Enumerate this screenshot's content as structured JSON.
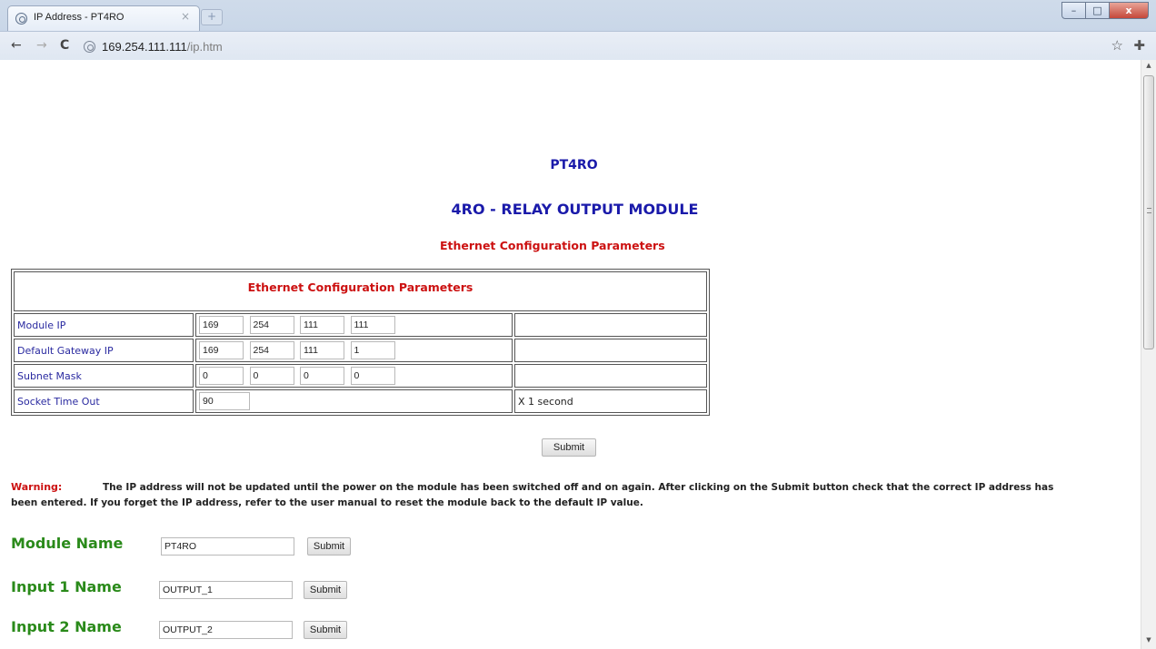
{
  "browser": {
    "tab_title": "IP Address - PT4RO",
    "tab_close": "×",
    "new_tab": "+",
    "url_host": "169.254.111.111",
    "url_path": "/ip.htm",
    "win_min": "–",
    "win_max": "□",
    "win_close": "x"
  },
  "header": {
    "module": "PT4RO",
    "title": "4RO - RELAY OUTPUT MODULE",
    "subtitle": "Ethernet Configuration Parameters"
  },
  "config_table": {
    "heading": "Ethernet Configuration Parameters",
    "rows": [
      {
        "label": "Module IP",
        "octets": [
          "169",
          "254",
          "111",
          "111"
        ],
        "note": ""
      },
      {
        "label": "Default Gateway IP",
        "octets": [
          "169",
          "254",
          "111",
          "1"
        ],
        "note": ""
      },
      {
        "label": "Subnet Mask",
        "octets": [
          "0",
          "0",
          "0",
          "0"
        ],
        "note": ""
      },
      {
        "label": "Socket Time Out",
        "value": "90",
        "note": "X 1 second"
      }
    ],
    "submit_label": "Submit"
  },
  "warning": {
    "label": "Warning:",
    "line1": "The IP address will not be updated until the power on the module has been switched off and on again. After clicking on the Submit button check that the correct IP address has",
    "line2": "been entered. If you forget the IP address, refer to the user manual to reset the module back to the default IP value."
  },
  "names": [
    {
      "label": "Module Name",
      "value": "PT4RO",
      "submit": "Submit"
    },
    {
      "label": "Input 1 Name",
      "value": "OUTPUT_1",
      "submit": "Submit"
    },
    {
      "label": "Input 2 Name",
      "value": "OUTPUT_2",
      "submit": "Submit"
    }
  ],
  "icons": {
    "back": "back-arrow-icon",
    "forward": "forward-arrow-icon",
    "reload": "reload-icon",
    "bookmark": "star-icon",
    "menu": "wrench-icon"
  }
}
